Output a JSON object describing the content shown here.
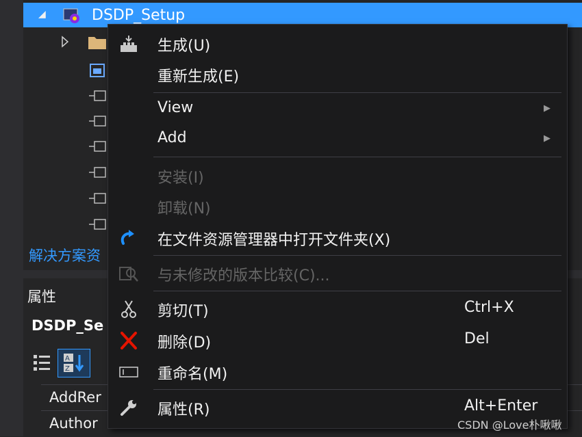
{
  "colors": {
    "selection": "#3399ff",
    "menu_bg": "#1b1b1c",
    "panel_bg": "#252526",
    "text": "#f1f1f1",
    "disabled_text": "#656565",
    "delete_red": "#e51400",
    "refresh_blue": "#1e90ff"
  },
  "tree": {
    "project_label": "DSDP_Setup"
  },
  "solution_explorer_tab": "解决方案资",
  "properties": {
    "title": "属性",
    "object_name": "DSDP_Se",
    "rows": [
      "AddRer",
      "Author"
    ]
  },
  "context_menu": {
    "items": [
      {
        "label": "生成(U)",
        "icon": "build-icon"
      },
      {
        "label": "重新生成(E)"
      },
      {
        "label": "View",
        "submenu": true
      },
      {
        "label": "Add",
        "submenu": true
      },
      {
        "label": "安装(I)",
        "disabled": true
      },
      {
        "label": "卸载(N)",
        "disabled": true
      },
      {
        "label": "在文件资源管理器中打开文件夹(X)",
        "icon": "open-folder-refresh-icon"
      },
      {
        "label": "与未修改的版本比较(C)...",
        "icon": "compare-icon",
        "disabled": true
      },
      {
        "label": "剪切(T)",
        "shortcut": "Ctrl+X",
        "icon": "scissors-icon"
      },
      {
        "label": "删除(D)",
        "shortcut": "Del",
        "icon": "delete-x-icon"
      },
      {
        "label": "重命名(M)",
        "icon": "rename-icon"
      },
      {
        "label": "属性(R)",
        "shortcut": "Alt+Enter",
        "icon": "wrench-icon"
      }
    ]
  },
  "watermark": "CSDN @Love朴啾啾"
}
